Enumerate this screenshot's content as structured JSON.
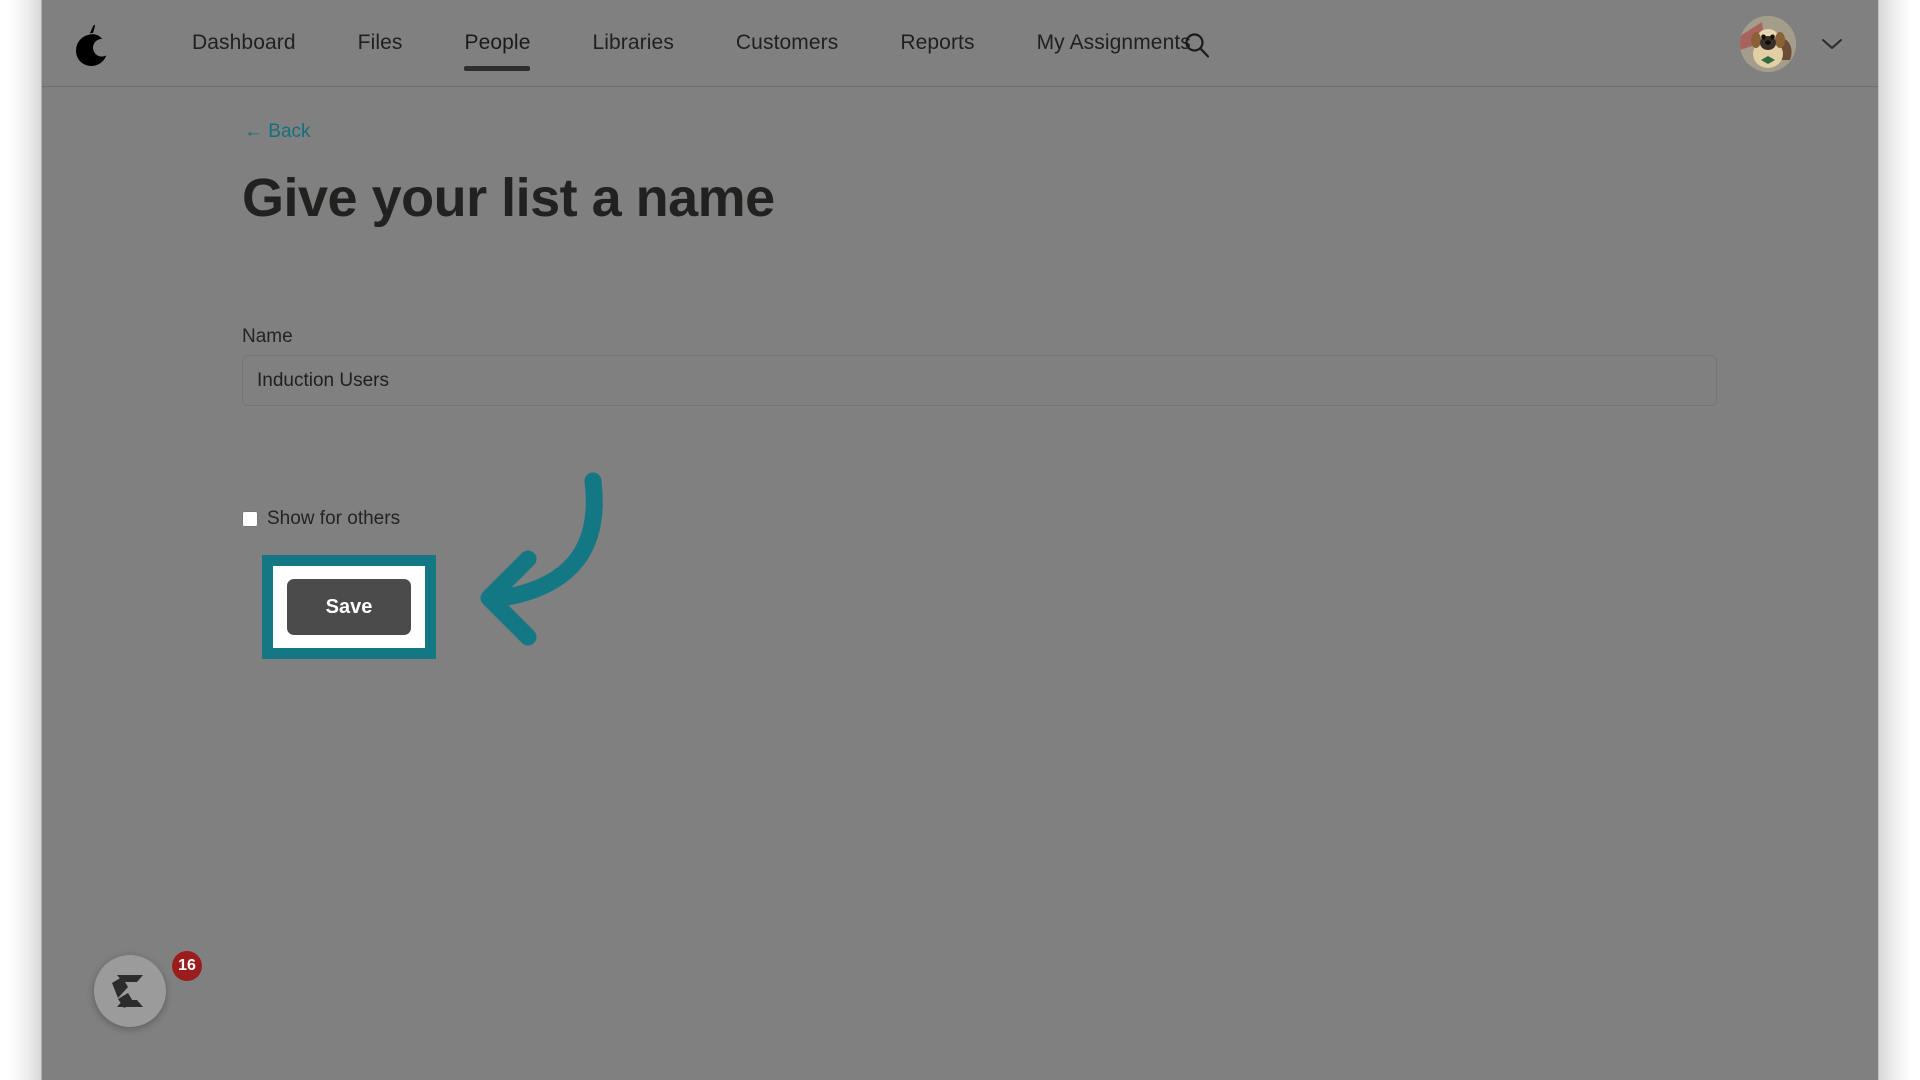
{
  "colors": {
    "accent_teal": "#147784",
    "page_background": "#808080",
    "nav_text": "#21201f",
    "save_button_bg": "#4b4b4b",
    "badge_red": "#9b1c1c",
    "link_teal": "#14707d"
  },
  "topnav": {
    "logo_name": "pear-logo",
    "items": [
      {
        "label": "Dashboard",
        "active": false
      },
      {
        "label": "Files",
        "active": false
      },
      {
        "label": "People",
        "active": true
      },
      {
        "label": "Libraries",
        "active": false
      },
      {
        "label": "Customers",
        "active": false
      },
      {
        "label": "Reports",
        "active": false
      },
      {
        "label": "My Assignments",
        "active": false
      }
    ],
    "search_icon": "search-icon",
    "avatar_icon": "user-avatar-dog-photo",
    "avatar_chevron_icon": "chevron-down-icon"
  },
  "content": {
    "back_link": "← Back",
    "title": "Give your list a name",
    "name_label": "Name",
    "name_value": "Induction Users",
    "name_placeholder": "",
    "show_for_others_label": "Show for others",
    "show_for_others_checked": false,
    "save_label": "Save"
  },
  "annotation": {
    "arrow_icon": "curved-left-arrow-annotation",
    "highlight_target": "save-button"
  },
  "chat_widget": {
    "icon": "chat-widget-logo-icon",
    "badge_count": "16"
  }
}
